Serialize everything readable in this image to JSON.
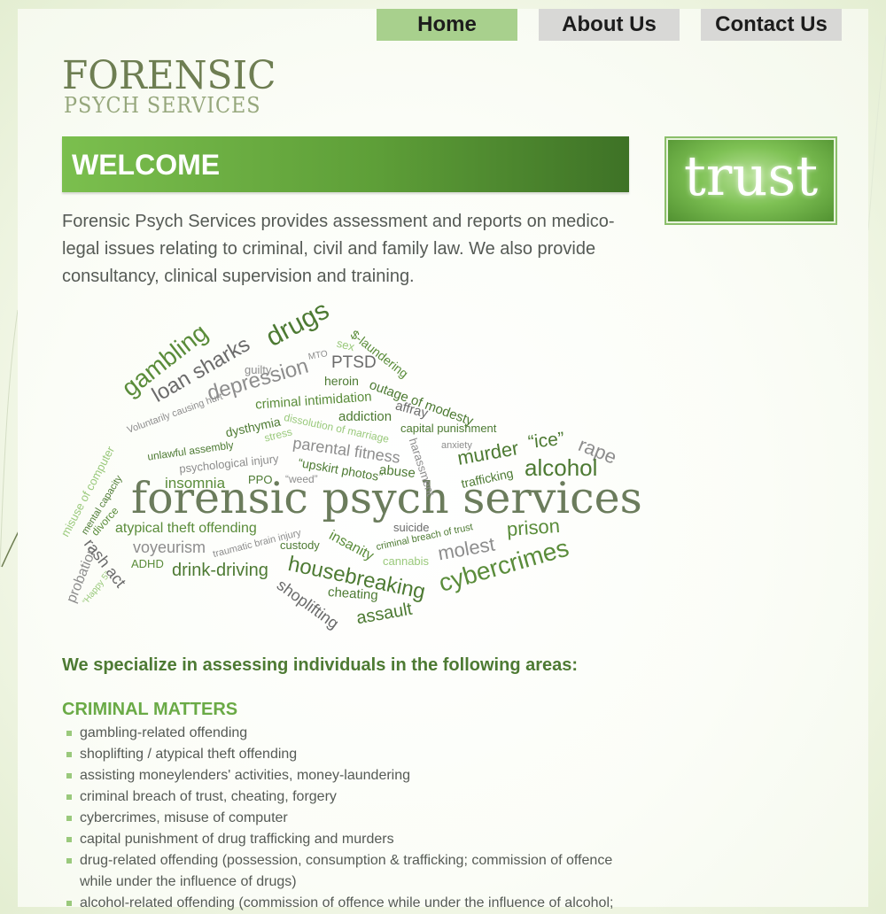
{
  "nav": {
    "home": "Home",
    "about": "About Us",
    "contact": "Contact Us"
  },
  "logo": {
    "line1": "FORENSIC",
    "line2": "PSYCH SERVICES"
  },
  "welcome": {
    "title": "WELCOME"
  },
  "trust_badge": {
    "word": "trust"
  },
  "intro": "Forensic Psych Services provides assessment and reports on medico-legal issues relating to criminal, civil and family law. We also provide consultancy, clinical supervision and training.",
  "word_cloud": {
    "center": "forensic psych services",
    "words": {
      "drugs": "drugs",
      "gambling": "gambling",
      "loan_sharks": "loan sharks",
      "depression": "depression",
      "guilty": "guilty",
      "mto": "MTO",
      "sex": "sex",
      "s_laundering": "$-laundering",
      "ptsd": "PTSD",
      "heroin": "heroin",
      "outage": "outage of modesty",
      "criminal_intimidation": "criminal intimidation",
      "affray": "affray",
      "voluntarily": "Voluntarily causing hurt",
      "dysthymia": "dysthymia",
      "dissolution": "dissolution of marriage",
      "addiction": "addiction",
      "capital_punishment": "capital punishment",
      "unlawful_assembly": "unlawful assembly",
      "stress": "stress",
      "parental_fitness": "parental fitness",
      "harassment": "harassment",
      "anxiety": "anxiety",
      "ice": "“ice”",
      "rape": "rape",
      "misuse": "misuse of computer",
      "mental_capacity": "mental capacity",
      "psychological_injury": "psychological injury",
      "upskirt": "“upskirt photos”",
      "abuse": "abuse",
      "murder": "murder",
      "trafficking": "trafficking",
      "alcohol": "alcohol",
      "insomnia": "insomnia",
      "ppo": "PPO",
      "weed": "“weed”",
      "divorce": "divorce",
      "atypical": "atypical theft offending",
      "suicide": "suicide",
      "traumatic": "traumatic brain injury",
      "breach": "criminal breach of trust",
      "prison": "prison",
      "probation": "probation",
      "rash_act": "rash act",
      "happy5": "“Happy 5”",
      "voyeurism": "voyeurism",
      "custody": "custody",
      "insanity": "insanity",
      "cannabis": "cannabis",
      "molest": "molest",
      "adhd": "ADHD",
      "drink_driving": "drink-driving",
      "housebreaking": "housebreaking",
      "cybercrimes": "cybercrimes",
      "cheating": "cheating",
      "shoplifting": "shoplifting",
      "assault": "assault"
    }
  },
  "specialize": "We specialize in assessing individuals in the following areas:",
  "criminal": {
    "heading": "CRIMINAL MATTERS",
    "items": [
      "gambling-related offending",
      "shoplifting / atypical theft offending",
      "assisting moneylenders' activities, money-laundering",
      "criminal breach of trust, cheating, forgery",
      "cybercrimes, misuse of computer",
      "capital punishment of drug trafficking and murders",
      "drug-related offending (possession, consumption & trafficking; commission of offence while under the influence of drugs)",
      "alcohol-related offending (commission of offence while under the influence of alcohol;"
    ]
  },
  "colors": {
    "nav_active": "#a8d08d",
    "nav_inactive": "#d8d8d6",
    "brand_green": "#4d7a33",
    "accent_green": "#6aaa46",
    "text": "#555a55"
  }
}
